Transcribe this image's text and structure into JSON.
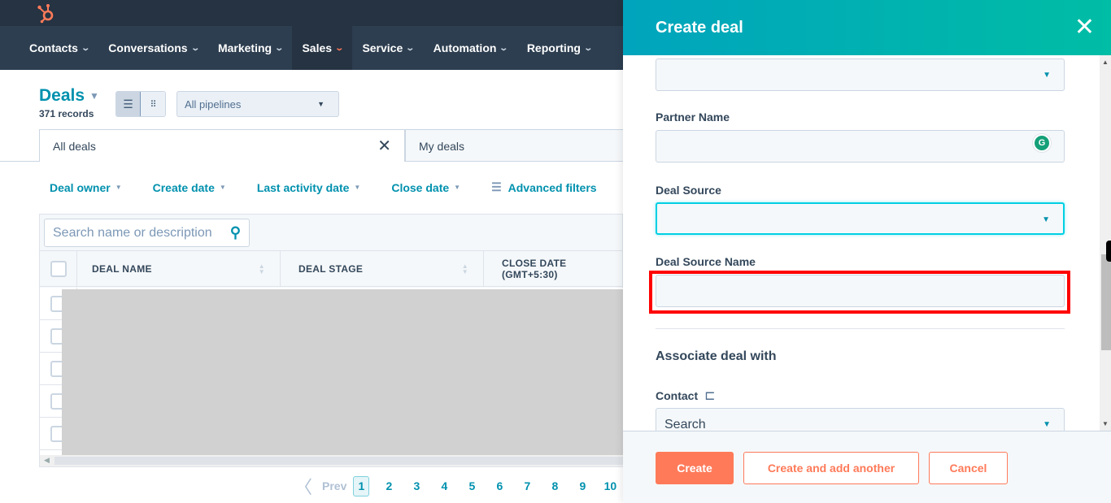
{
  "nav": {
    "items": [
      {
        "label": "Contacts",
        "active": false
      },
      {
        "label": "Conversations",
        "active": false
      },
      {
        "label": "Marketing",
        "active": false
      },
      {
        "label": "Sales",
        "active": true
      },
      {
        "label": "Service",
        "active": false
      },
      {
        "label": "Automation",
        "active": false
      },
      {
        "label": "Reporting",
        "active": false
      }
    ],
    "chevron": "⌄"
  },
  "header": {
    "title": "Deals",
    "records": "371 records",
    "pipeline_select": "All pipelines"
  },
  "tabs": [
    {
      "label": "All deals",
      "active": true
    },
    {
      "label": "My deals",
      "active": false
    }
  ],
  "filters": [
    {
      "label": "Deal owner"
    },
    {
      "label": "Create date"
    },
    {
      "label": "Last activity date"
    },
    {
      "label": "Close date"
    },
    {
      "label": "Advanced filters"
    }
  ],
  "table": {
    "search_placeholder": "Search name or description",
    "columns": [
      "DEAL NAME",
      "DEAL STAGE",
      "CLOSE DATE (GMT+5:30)"
    ],
    "row_count": 5
  },
  "pagination": {
    "prev_label": "Prev",
    "pages": [
      "1",
      "2",
      "3",
      "4",
      "5",
      "6",
      "7",
      "8",
      "9",
      "10"
    ],
    "current": "1"
  },
  "panel": {
    "title": "Create deal",
    "fields": {
      "top_select_value": "",
      "partner_name_label": "Partner Name",
      "partner_name_value": "",
      "deal_source_label": "Deal Source",
      "deal_source_value": "",
      "deal_source_name_label": "Deal Source Name",
      "deal_source_name_value": ""
    },
    "associate_title": "Associate deal with",
    "contact_label": "Contact",
    "contact_search_placeholder": "Search",
    "buttons": {
      "create": "Create",
      "create_another": "Create and add another",
      "cancel": "Cancel"
    }
  },
  "colors": {
    "accent_teal": "#0091ae",
    "primary_orange": "#ff7a59",
    "nav_dark": "#2d3e50",
    "highlight_red": "#ff0000"
  }
}
